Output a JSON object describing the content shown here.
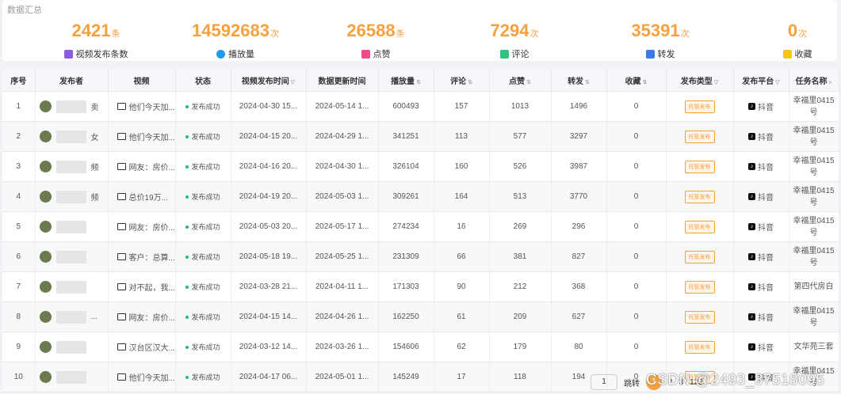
{
  "summary": {
    "title": "数据汇总",
    "stats": [
      {
        "value": "2421",
        "unit": "条",
        "label": "视频发布条数",
        "icon": "book-icon",
        "color": "#8c5be0"
      },
      {
        "value": "14592683",
        "unit": "次",
        "label": "播放量",
        "icon": "play-icon",
        "color": "#1e9bf0"
      },
      {
        "value": "26588",
        "unit": "条",
        "label": "点赞",
        "icon": "heart-icon",
        "color": "#ef4b8c"
      },
      {
        "value": "7294",
        "unit": "次",
        "label": "评论",
        "icon": "comment-icon",
        "color": "#2ec27e"
      },
      {
        "value": "35391",
        "unit": "次",
        "label": "转发",
        "icon": "share-icon",
        "color": "#3b7be8"
      },
      {
        "value": "0",
        "unit": "次",
        "label": "收藏",
        "icon": "star-icon",
        "color": "#f5c518"
      }
    ]
  },
  "table": {
    "headers": [
      "序号",
      "发布者",
      "视频",
      "状态",
      "视频发布时间",
      "数据更新时间",
      "播放量",
      "评论",
      "点赞",
      "转发",
      "收藏",
      "发布类型",
      "发布平台",
      "任务名称"
    ],
    "rows": [
      {
        "idx": "1",
        "publisher": "卖",
        "video": "他们今天加...",
        "status": "发布成功",
        "pub": "2024-04-30 15...",
        "upd": "2024-05-14 1...",
        "plays": "600493",
        "comments": "157",
        "likes": "1013",
        "shares": "1496",
        "favs": "0",
        "type": "托管发布",
        "platform": "抖音",
        "task": "幸福里0415号"
      },
      {
        "idx": "2",
        "publisher": "女",
        "video": "他们今天加...",
        "status": "发布成功",
        "pub": "2024-04-15 20...",
        "upd": "2024-04-29 1...",
        "plays": "341251",
        "comments": "113",
        "likes": "577",
        "shares": "3297",
        "favs": "0",
        "type": "托管发布",
        "platform": "抖音",
        "task": "幸福里0415号"
      },
      {
        "idx": "3",
        "publisher": "频",
        "video": "网友：房价...",
        "status": "发布成功",
        "pub": "2024-04-16 20...",
        "upd": "2024-04-30 1...",
        "plays": "326104",
        "comments": "160",
        "likes": "526",
        "shares": "3987",
        "favs": "0",
        "type": "托管发布",
        "platform": "抖音",
        "task": "幸福里0415号"
      },
      {
        "idx": "4",
        "publisher": "频",
        "video": "总价19万...",
        "status": "发布成功",
        "pub": "2024-04-19 20...",
        "upd": "2024-05-03 1...",
        "plays": "309261",
        "comments": "164",
        "likes": "513",
        "shares": "3770",
        "favs": "0",
        "type": "托管发布",
        "platform": "抖音",
        "task": "幸福里0415号"
      },
      {
        "idx": "5",
        "publisher": "",
        "video": "网友：房价...",
        "status": "发布成功",
        "pub": "2024-05-03 20...",
        "upd": "2024-05-17 1...",
        "plays": "274234",
        "comments": "16",
        "likes": "269",
        "shares": "296",
        "favs": "0",
        "type": "托管发布",
        "platform": "抖音",
        "task": "幸福里0415号"
      },
      {
        "idx": "6",
        "publisher": "",
        "video": "客户：总算...",
        "status": "发布成功",
        "pub": "2024-05-18 19...",
        "upd": "2024-05-25 1...",
        "plays": "231309",
        "comments": "66",
        "likes": "381",
        "shares": "827",
        "favs": "0",
        "type": "托管发布",
        "platform": "抖音",
        "task": "幸福里0415号"
      },
      {
        "idx": "7",
        "publisher": "",
        "video": "对不起，我...",
        "status": "发布成功",
        "pub": "2024-03-28 21...",
        "upd": "2024-04-11 1...",
        "plays": "171303",
        "comments": "90",
        "likes": "212",
        "shares": "368",
        "favs": "0",
        "type": "托管发布",
        "platform": "抖音",
        "task": "第四代房白"
      },
      {
        "idx": "8",
        "publisher": "...",
        "video": "网友：房价...",
        "status": "发布成功",
        "pub": "2024-04-15 14...",
        "upd": "2024-04-26 1...",
        "plays": "162250",
        "comments": "61",
        "likes": "209",
        "shares": "627",
        "favs": "0",
        "type": "托管发布",
        "platform": "抖音",
        "task": "幸福里0415号"
      },
      {
        "idx": "9",
        "publisher": "",
        "video": "汉台区汉大...",
        "status": "发布成功",
        "pub": "2024-03-12 14...",
        "upd": "2024-03-26 1...",
        "plays": "154606",
        "comments": "62",
        "likes": "179",
        "shares": "80",
        "favs": "0",
        "type": "托管发布",
        "platform": "抖音",
        "task": "文华苑三套"
      },
      {
        "idx": "10",
        "publisher": "",
        "video": "他们今天加...",
        "status": "发布成功",
        "pub": "2024-04-17 06...",
        "upd": "2024-05-01 1...",
        "plays": "145249",
        "comments": "17",
        "likes": "118",
        "shares": "194",
        "favs": "0",
        "type": "托管发布",
        "platform": "抖音",
        "task": "幸福里0415号"
      }
    ]
  },
  "pager": {
    "jump_value": "1",
    "jump_label": "跳转",
    "current": "1",
    "next": "2",
    "more": "3",
    "last": "122"
  },
  "watermark": "CSDN @2493_87518095"
}
